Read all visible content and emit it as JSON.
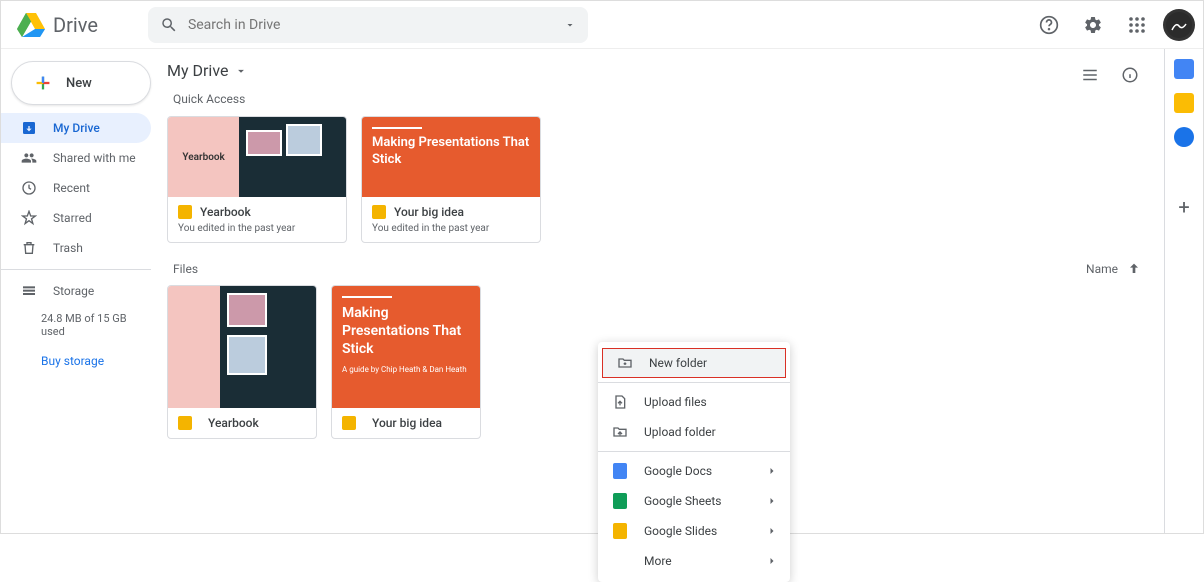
{
  "app": {
    "name": "Drive"
  },
  "search": {
    "placeholder": "Search in Drive"
  },
  "header_icons": {
    "help": "help-icon",
    "settings": "gear-icon",
    "apps": "apps-grid-icon"
  },
  "new_button": {
    "label": "New"
  },
  "nav": [
    {
      "id": "my-drive",
      "label": "My Drive",
      "icon": "drive-icon",
      "active": true
    },
    {
      "id": "shared",
      "label": "Shared with me",
      "icon": "people-icon",
      "active": false
    },
    {
      "id": "recent",
      "label": "Recent",
      "icon": "clock-icon",
      "active": false
    },
    {
      "id": "starred",
      "label": "Starred",
      "icon": "star-icon",
      "active": false
    },
    {
      "id": "trash",
      "label": "Trash",
      "icon": "trash-icon",
      "active": false
    }
  ],
  "storage": {
    "label": "Storage",
    "usage": "24.8 MB of 15 GB used",
    "buy": "Buy storage"
  },
  "breadcrumb": {
    "title": "My Drive"
  },
  "sections": {
    "quick_access": "Quick Access",
    "files": "Files"
  },
  "sort": {
    "label": "Name",
    "direction": "asc"
  },
  "quick_access": [
    {
      "title": "Yearbook",
      "subtitle": "You edited in the past year",
      "type": "slides",
      "preview": "yearbook",
      "preview_text": "Yearbook"
    },
    {
      "title": "Your big idea",
      "subtitle": "You edited in the past year",
      "type": "slides",
      "preview": "orange",
      "preview_title": "Making Presentations That Stick"
    }
  ],
  "files": [
    {
      "title": "Yearbook",
      "type": "slides",
      "preview": "yearbook"
    },
    {
      "title": "Your big idea",
      "type": "slides",
      "preview": "orange",
      "preview_title": "Making Presentations That Stick",
      "preview_subtitle": "A guide by Chip Heath & Dan Heath"
    }
  ],
  "context_menu": {
    "highlighted": 0,
    "items": [
      {
        "label": "New folder",
        "icon": "folder-plus-icon",
        "chevron": false
      },
      {
        "divider": true
      },
      {
        "label": "Upload files",
        "icon": "file-upload-icon",
        "chevron": false
      },
      {
        "label": "Upload folder",
        "icon": "folder-upload-icon",
        "chevron": false
      },
      {
        "divider": true
      },
      {
        "label": "Google Docs",
        "icon": "docs-icon",
        "color": "#4285f4",
        "chevron": true
      },
      {
        "label": "Google Sheets",
        "icon": "sheets-icon",
        "color": "#0f9d58",
        "chevron": true
      },
      {
        "label": "Google Slides",
        "icon": "slides-icon",
        "color": "#f4b400",
        "chevron": true
      },
      {
        "label": "More",
        "icon": "",
        "chevron": true
      }
    ]
  },
  "colors": {
    "accent": "#1a73e8",
    "orange": "#e65b2e",
    "pink": "#f4c5c0",
    "dark": "#1a2d36"
  }
}
